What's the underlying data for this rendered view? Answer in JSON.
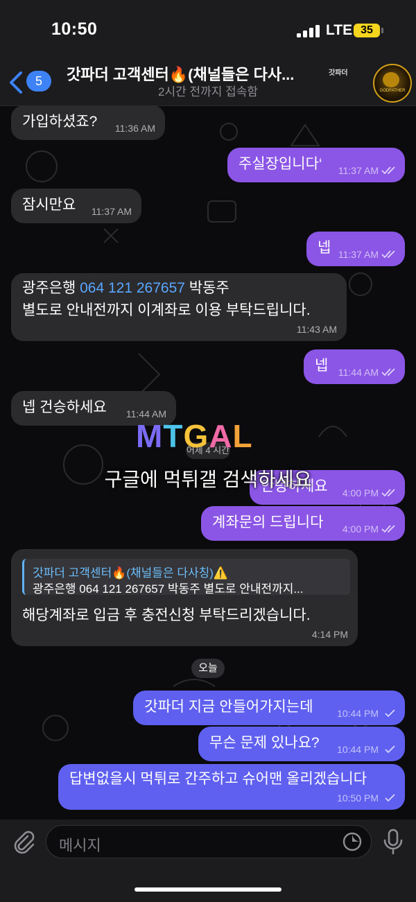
{
  "status_bar": {
    "time": "10:50",
    "network": "LTE",
    "battery": "35"
  },
  "header": {
    "back_badge": "5",
    "title": "갓파더 고객센터🔥(채널들은 다사...",
    "title_tag": "갓파더",
    "subtitle": "2시간 전까지 접속함",
    "avatar_text": "GODFATHER"
  },
  "messages": [
    {
      "dir": "in",
      "text": "가입하셨죠?",
      "time": "11:36 AM"
    },
    {
      "dir": "out",
      "text": "주실장입니다‘",
      "time": "11:37 AM"
    },
    {
      "dir": "in",
      "text": "잠시만요",
      "time": "11:37 AM"
    },
    {
      "dir": "out",
      "text": "넵",
      "time": "11:37 AM"
    },
    {
      "dir": "in",
      "line1_prefix": "광주은행 ",
      "line1_link": "064 121 267657",
      "line1_suffix": " 박동주",
      "line2": "별도로 안내전까지 이계좌로 이용 부탁드립니다.",
      "time": "11:43 AM"
    },
    {
      "dir": "out",
      "text": "넵",
      "time": "11:44 AM"
    },
    {
      "dir": "in",
      "text": "넵 건승하세요",
      "time": "11:44 AM"
    },
    {
      "dir": "out",
      "text": "안녕하세요",
      "time": "4:00 PM"
    },
    {
      "dir": "out",
      "text": "계좌문의 드립니다",
      "time": "4:00 PM"
    },
    {
      "dir": "in",
      "reply_name": "갓파더 고객센터🔥(채널들은 다사칭)⚠️",
      "reply_snippet": "광주은행 064 121 267657 박동주 별도로 안내전까지...",
      "text": "해당계좌로 입금 후 충전신청 부탁드리겠습니다.",
      "time": "4:14 PM"
    },
    {
      "dir": "out",
      "text": "갓파더 지금 안들어가지는데",
      "time": "10:44 PM"
    },
    {
      "dir": "out",
      "text": "무슨 문제 있나요?",
      "time": "10:44 PM"
    },
    {
      "dir": "out",
      "text": "답변없을시 먹튀로 간주하고 슈어맨 올리겠습니다",
      "time": "10:50 PM"
    }
  ],
  "date_separators": {
    "ghost": "어제 4 시간",
    "today": "오늘"
  },
  "watermark": {
    "logo": "MTGAL",
    "caption": "구글에 먹튀갤 검색하세요"
  },
  "input": {
    "placeholder": "메시지"
  },
  "colors": {
    "outgoing": "#8b55e6",
    "outgoing_today": "#5f5ff0",
    "incoming": "#2b2b2e",
    "link": "#5aa7ff",
    "accent": "#3e82f7"
  }
}
